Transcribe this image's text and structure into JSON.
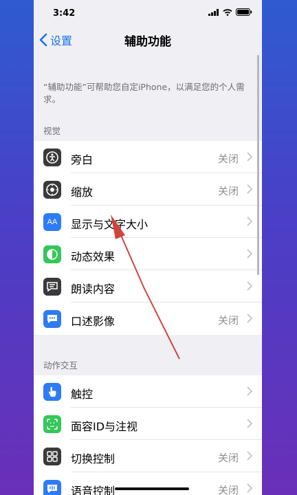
{
  "status_bar": {
    "time": "3:42"
  },
  "nav": {
    "back_label": "设置",
    "title": "辅助功能"
  },
  "intro": "“辅助功能”可帮助您自定iPhone，以满足您的个人需求。",
  "sections": [
    {
      "header": "视觉",
      "items": [
        {
          "label": "旁白",
          "value": "关闭",
          "icon": "voiceover-icon",
          "color": "#3a3a3c"
        },
        {
          "label": "缩放",
          "value": "关闭",
          "icon": "zoom-icon",
          "color": "#3a3a3c"
        },
        {
          "label": "显示与文字大小",
          "value": "",
          "icon": "text-size-icon",
          "icon_text": "AA",
          "color": "#2f7bf6"
        },
        {
          "label": "动态效果",
          "value": "",
          "icon": "motion-icon",
          "color": "#34c759"
        },
        {
          "label": "朗读内容",
          "value": "",
          "icon": "spoken-content-icon",
          "color": "#3a3a3c"
        },
        {
          "label": "口述影像",
          "value": "关闭",
          "icon": "audio-description-icon",
          "color": "#2f7bf6"
        }
      ]
    },
    {
      "header": "动作交互",
      "items": [
        {
          "label": "触控",
          "value": "",
          "icon": "touch-icon",
          "color": "#2f7bf6"
        },
        {
          "label": "面容ID与注视",
          "value": "",
          "icon": "face-id-icon",
          "color": "#34c759"
        },
        {
          "label": "切换控制",
          "value": "关闭",
          "icon": "switch-control-icon",
          "color": "#3a3a3c"
        },
        {
          "label": "语音控制",
          "value": "关闭",
          "icon": "voice-control-icon",
          "color": "#2f7bf6"
        }
      ]
    }
  ],
  "accent_color": "#1a73e8",
  "annotation_arrow_color": "#d0453a"
}
